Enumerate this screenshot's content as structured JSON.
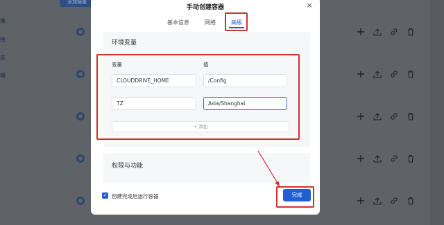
{
  "background": {
    "top_button": "添加镜像",
    "side_texts": [
      "像",
      "络",
      "态",
      "曝"
    ]
  },
  "modal": {
    "title": "手动创建容器",
    "close_glyph": "×",
    "tabs": [
      {
        "label": "基本信息"
      },
      {
        "label": "网络"
      },
      {
        "label": "高级"
      }
    ],
    "env_section": {
      "title": "环境变量",
      "col_key": "变量",
      "col_value": "值",
      "rows": [
        {
          "key": "CLOUDDRIVE_HOME",
          "value": "/Config"
        },
        {
          "key": "TZ",
          "value": "Asia/Shanghai"
        }
      ],
      "add_label": "+ 添加"
    },
    "perm_section": {
      "title": "权限与功能"
    },
    "footer": {
      "checkbox_label": "创建完成后运行容器",
      "checked": true,
      "done_label": "完成"
    }
  },
  "colors": {
    "accent": "#1f5fd6",
    "annotation": "#d0312d"
  }
}
